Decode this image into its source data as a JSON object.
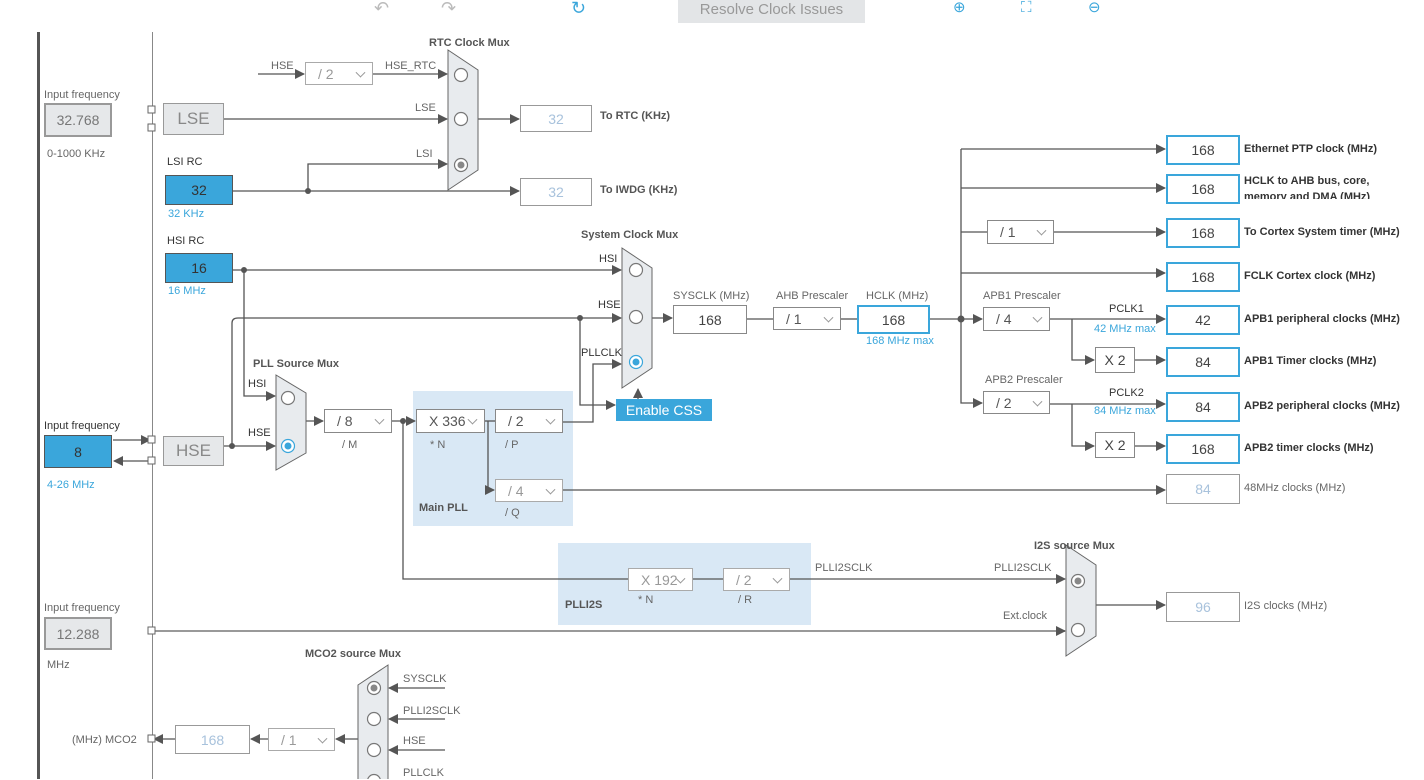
{
  "toolbar": {
    "undo_icon": "undo-icon",
    "redo_icon": "redo-icon",
    "refresh_icon": "refresh-icon",
    "resolve_label": "Resolve Clock Issues",
    "zoom_in_icon": "zoom-in-icon",
    "fit_icon": "fit-to-screen-icon",
    "zoom_out_icon": "zoom-out-icon"
  },
  "lse": {
    "input_label": "Input frequency",
    "input_value": "32.768",
    "range": "0-1000 KHz",
    "name": "LSE"
  },
  "lsi": {
    "label": "LSI RC",
    "value": "32",
    "unit": "32 KHz"
  },
  "hsi": {
    "label": "HSI RC",
    "value": "16",
    "unit": "16 MHz"
  },
  "hse": {
    "input_label": "Input frequency",
    "input_value": "8",
    "range": "4-26 MHz",
    "name": "HSE"
  },
  "ext_i2s": {
    "input_label": "Input frequency",
    "input_value": "12.288",
    "unit": "MHz"
  },
  "rtc_mux": {
    "title": "RTC Clock Mux",
    "hse_label": "HSE",
    "hse_div": "/ 2",
    "hse_rtc_label": "HSE_RTC",
    "lse_label": "LSE",
    "lsi_label": "LSI",
    "selected": "LSI"
  },
  "rtc_out": {
    "value": "32",
    "label": "To RTC (KHz)"
  },
  "iwdg_out": {
    "value": "32",
    "label": "To IWDG (KHz)"
  },
  "sys_mux": {
    "title": "System Clock Mux",
    "hsi": "HSI",
    "hse": "HSE",
    "pllclk": "PLLCLK",
    "selected": "PLLCLK"
  },
  "css_button": "Enable CSS",
  "sysclk": {
    "label": "SYSCLK (MHz)",
    "value": "168"
  },
  "ahb": {
    "label": "AHB Prescaler",
    "value": "/ 1"
  },
  "hclk": {
    "label": "HCLK (MHz)",
    "value": "168",
    "max": "168 MHz max"
  },
  "cortex_div": "/ 1",
  "apb1": {
    "label": "APB1 Prescaler",
    "value": "/ 4",
    "pclk": "PCLK1",
    "max": "42 MHz max",
    "timer_mult": "X 2"
  },
  "apb2": {
    "label": "APB2 Prescaler",
    "value": "/ 2",
    "pclk": "PCLK2",
    "max": "84 MHz max",
    "timer_mult": "X 2"
  },
  "outputs": [
    {
      "value": "168",
      "label": "Ethernet PTP clock (MHz)"
    },
    {
      "value": "168",
      "label": "HCLK to AHB bus, core,",
      "label2": "memory and DMA (MHz)"
    },
    {
      "value": "168",
      "label": "To Cortex System timer (MHz)"
    },
    {
      "value": "168",
      "label": "FCLK Cortex clock (MHz)"
    },
    {
      "value": "42",
      "label": "APB1 peripheral clocks (MHz)"
    },
    {
      "value": "84",
      "label": "APB1 Timer clocks (MHz)"
    },
    {
      "value": "84",
      "label": "APB2 peripheral clocks (MHz)"
    },
    {
      "value": "168",
      "label": "APB2 timer clocks (MHz)"
    },
    {
      "value": "84",
      "label": "48MHz clocks (MHz)"
    },
    {
      "value": "96",
      "label": "I2S clocks (MHz)"
    }
  ],
  "pll_src_mux": {
    "title": "PLL Source Mux",
    "hsi": "HSI",
    "hse": "HSE",
    "selected": "HSE"
  },
  "main_pll": {
    "title": "Main PLL",
    "m": "/ 8",
    "m_label": "/ M",
    "n": "X 336",
    "n_label": "* N",
    "p": "/ 2",
    "p_label": "/ P",
    "q": "/ 4",
    "q_label": "/ Q"
  },
  "plli2s": {
    "title": "PLLI2S",
    "n": "X 192",
    "n_label": "* N",
    "r": "/ 2",
    "r_label": "/ R",
    "out_label": "PLLI2SCLK"
  },
  "i2s_mux": {
    "title": "I2S source Mux",
    "plli2sclk": "PLLI2SCLK",
    "ext": "Ext.clock",
    "selected": "PLLI2SCLK"
  },
  "mco2": {
    "title": "MCO2 source Mux",
    "inputs": [
      "SYSCLK",
      "PLLI2SCLK",
      "HSE",
      "PLLCLK"
    ],
    "selected": "SYSCLK",
    "div": "/ 1",
    "value": "168",
    "label": "(MHz) MCO2"
  },
  "colors": {
    "accent": "#3aa6db",
    "wire": "#555555",
    "disabled_text": "#a8c2dc",
    "pll_bg": "#d9e8f5"
  }
}
